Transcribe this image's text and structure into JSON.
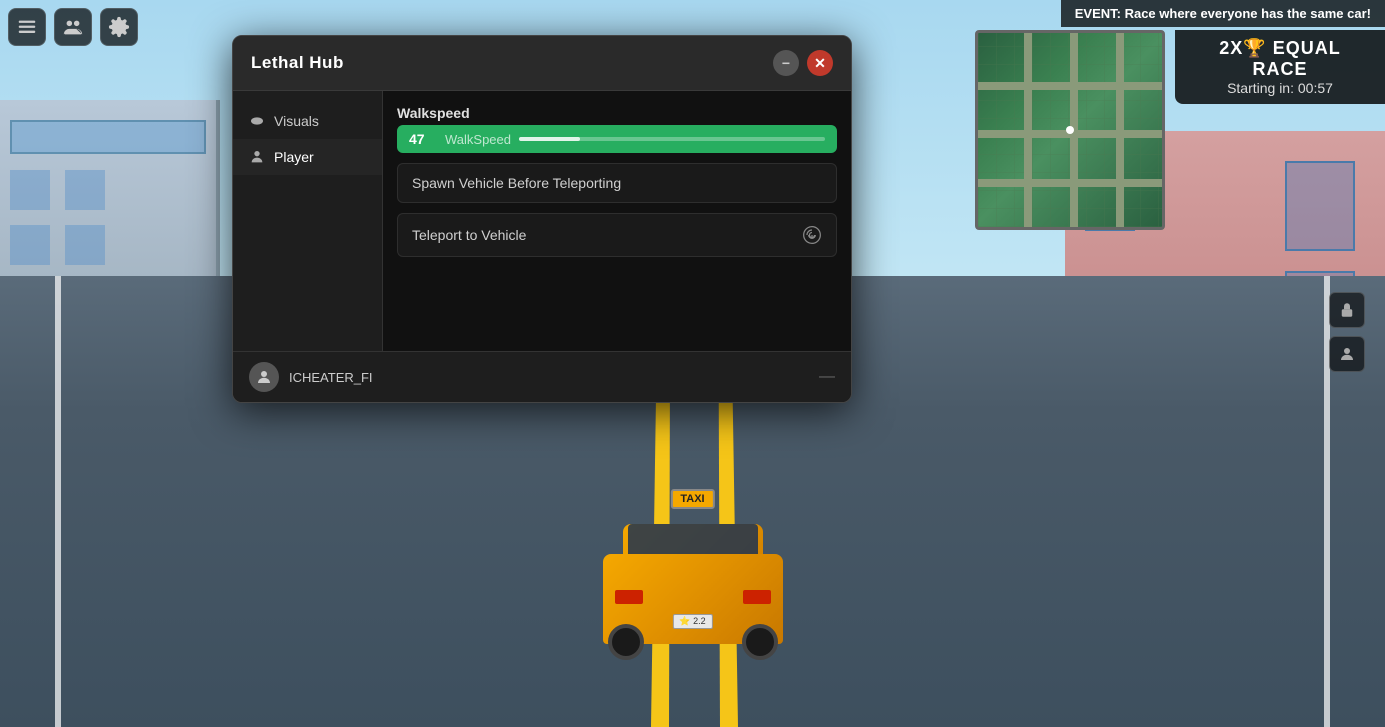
{
  "game": {
    "event_label": "EVENT: Race where everyone has the same car!",
    "event_title": "2X🏆 EQUAL RACE",
    "event_timer": "Starting in: 00:57",
    "taxi_sign": "TAXI",
    "taxi_plate": "⭐ 2.2"
  },
  "hud": {
    "icon1": "menu-icon",
    "icon2": "players-icon",
    "icon3": "settings-icon"
  },
  "modal": {
    "title": "Lethal Hub",
    "minimize_label": "−",
    "close_label": "✕",
    "sidebar": {
      "items": [
        {
          "id": "visuals",
          "label": "Visuals",
          "icon": "eye-icon"
        },
        {
          "id": "player",
          "label": "Player",
          "icon": "person-icon",
          "active": true
        }
      ]
    },
    "main": {
      "walkspeed_label": "Walkspeed",
      "walkspeed_value": "47",
      "walkspeed_placeholder": "WalkSpeed",
      "walkspeed_fill_pct": 20,
      "spawn_vehicle_label": "Spawn Vehicle Before Teleporting",
      "teleport_vehicle_label": "Teleport to Vehicle"
    },
    "footer": {
      "username": "ICHEATER_FI",
      "avatar_emoji": "👤",
      "dash": "—"
    }
  }
}
